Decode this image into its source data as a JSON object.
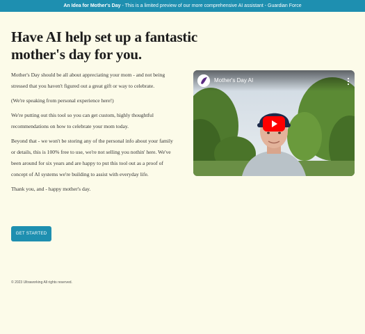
{
  "banner": {
    "bold_text": "An Idea for Mother's Day",
    "rest_text": " - This is a limited preview of our more comprehensive AI assistant - Guardian Force"
  },
  "hero": {
    "headline_line1": "Have AI help set up a fantastic",
    "headline_line2": "mother's day for you.",
    "paragraphs": [
      "Mother's Day should be all about appreciating your mom - and not being stressed that you haven't figured out a great gift or way to celebrate.",
      "(We're speaking from personal experience here!)",
      "We're putting out this tool so you can get custom, highly thoughtful recommendations on how to celebrate your mom today.",
      "Beyond that - we won't be storing any of the personal info about your family or details, this is 100% free to use, we're not selling you nothin' here. We've been around for six years and are happy to put this tool out as a proof of concept of AI systems we're building to assist with everyday life.",
      "Thank you, and - happy mother's day."
    ],
    "cta_label": "GET STARTED"
  },
  "video": {
    "title": "Mother's Day AI",
    "icons": [
      "channel-logo-icon",
      "more-vertical-icon",
      "youtube-play-icon"
    ]
  },
  "footer": {
    "copyright": "© 2023 Ultraworking All rights reserved."
  },
  "colors": {
    "background": "#fcfbe9",
    "accent": "#1e8fb0",
    "play_red": "#ff0000"
  }
}
